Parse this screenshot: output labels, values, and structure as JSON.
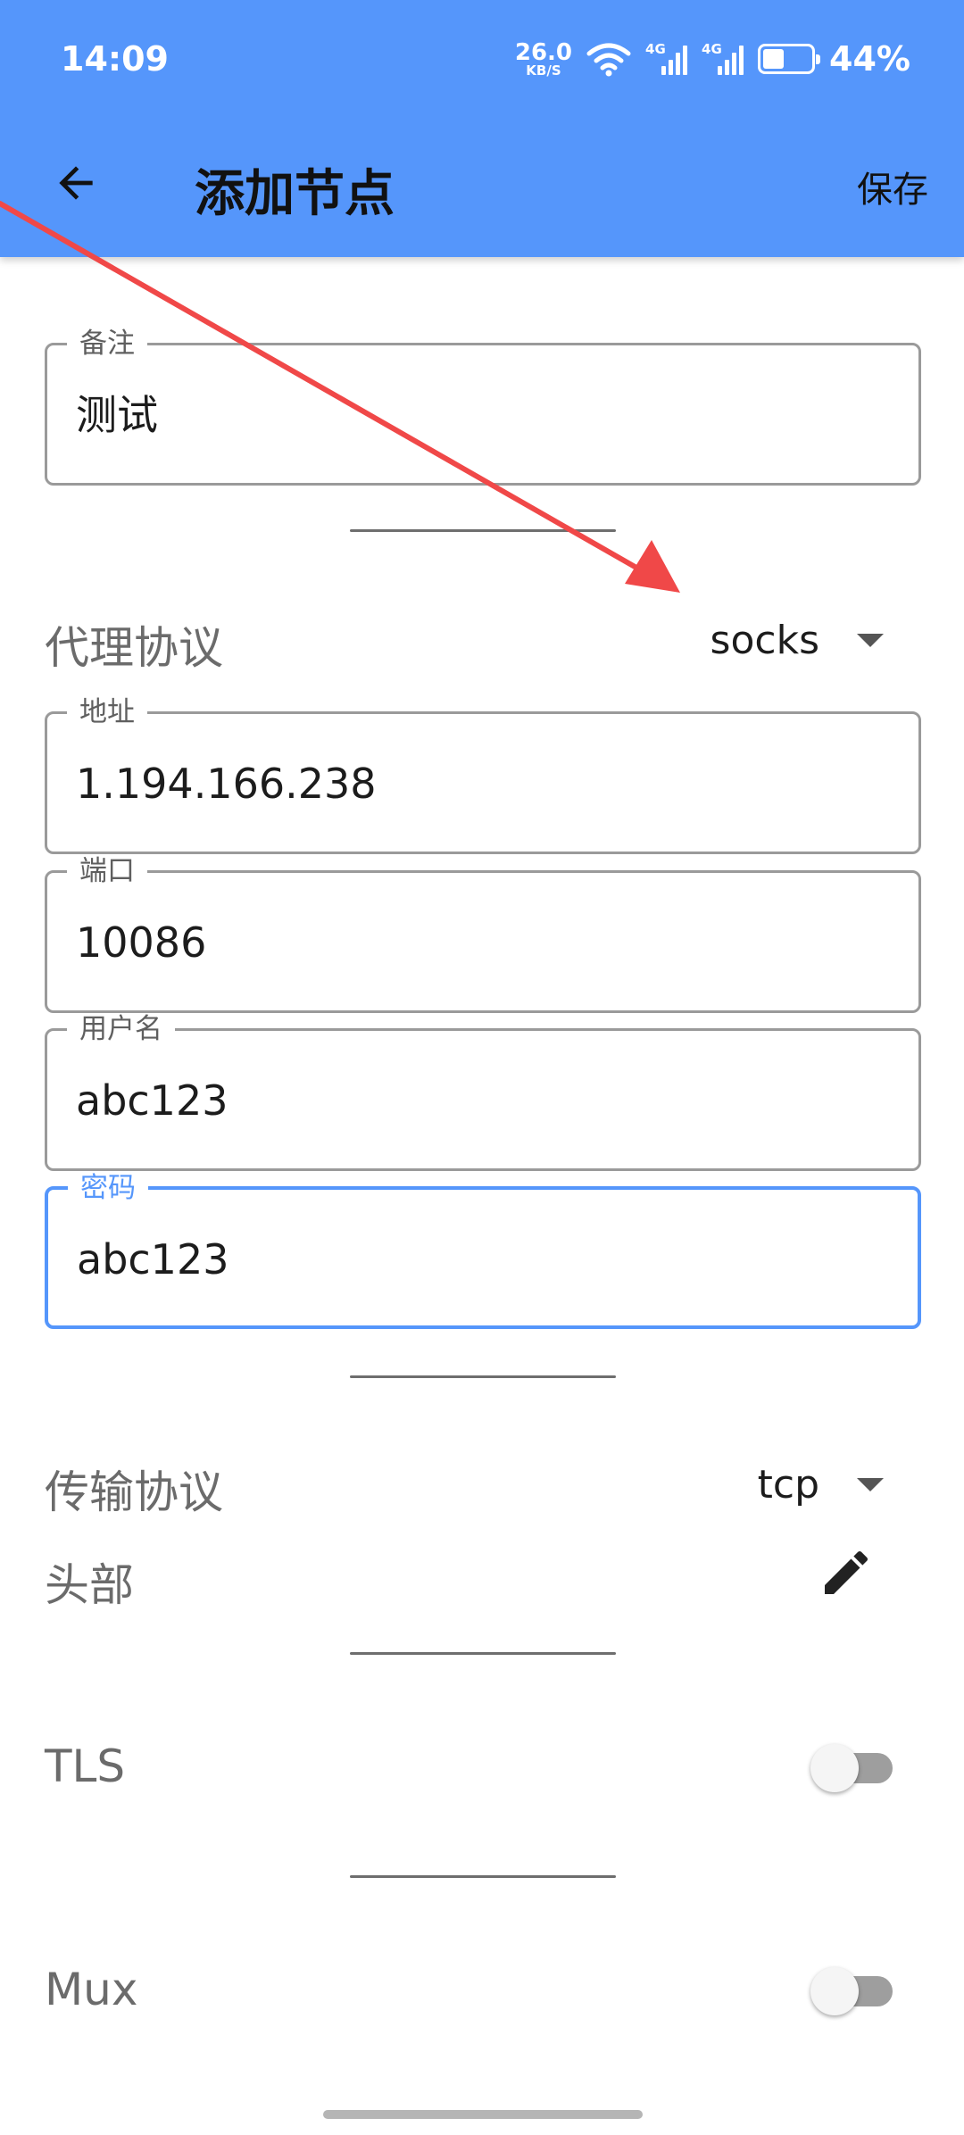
{
  "status_bar": {
    "time": "14:09",
    "net_speed_value": "26.0",
    "net_speed_unit": "KB/S",
    "signal1_label": "4G",
    "signal2_label": "4G",
    "battery_percent_text": "44%",
    "battery_level": 0.44
  },
  "toolbar": {
    "title": "添加节点",
    "save_label": "保存",
    "back_icon": "arrow-back-icon"
  },
  "form": {
    "remark": {
      "label": "备注",
      "value": "测试"
    },
    "proxy_protocol": {
      "label": "代理协议",
      "selected": "socks"
    },
    "address": {
      "label": "地址",
      "value": "1.194.166.238"
    },
    "port": {
      "label": "端口",
      "value": "10086"
    },
    "username": {
      "label": "用户名",
      "value": "abc123"
    },
    "password": {
      "label": "密码",
      "value": "abc123"
    },
    "transport_protocol": {
      "label": "传输协议",
      "selected": "tcp"
    },
    "header": {
      "label": "头部",
      "icon": "edit-pencil-icon"
    },
    "tls": {
      "label": "TLS",
      "enabled": false
    },
    "mux": {
      "label": "Mux",
      "enabled": false
    }
  },
  "colors": {
    "app_bar": "#5596fb",
    "accent": "#5596fb",
    "annotation_arrow": "#f04848"
  }
}
